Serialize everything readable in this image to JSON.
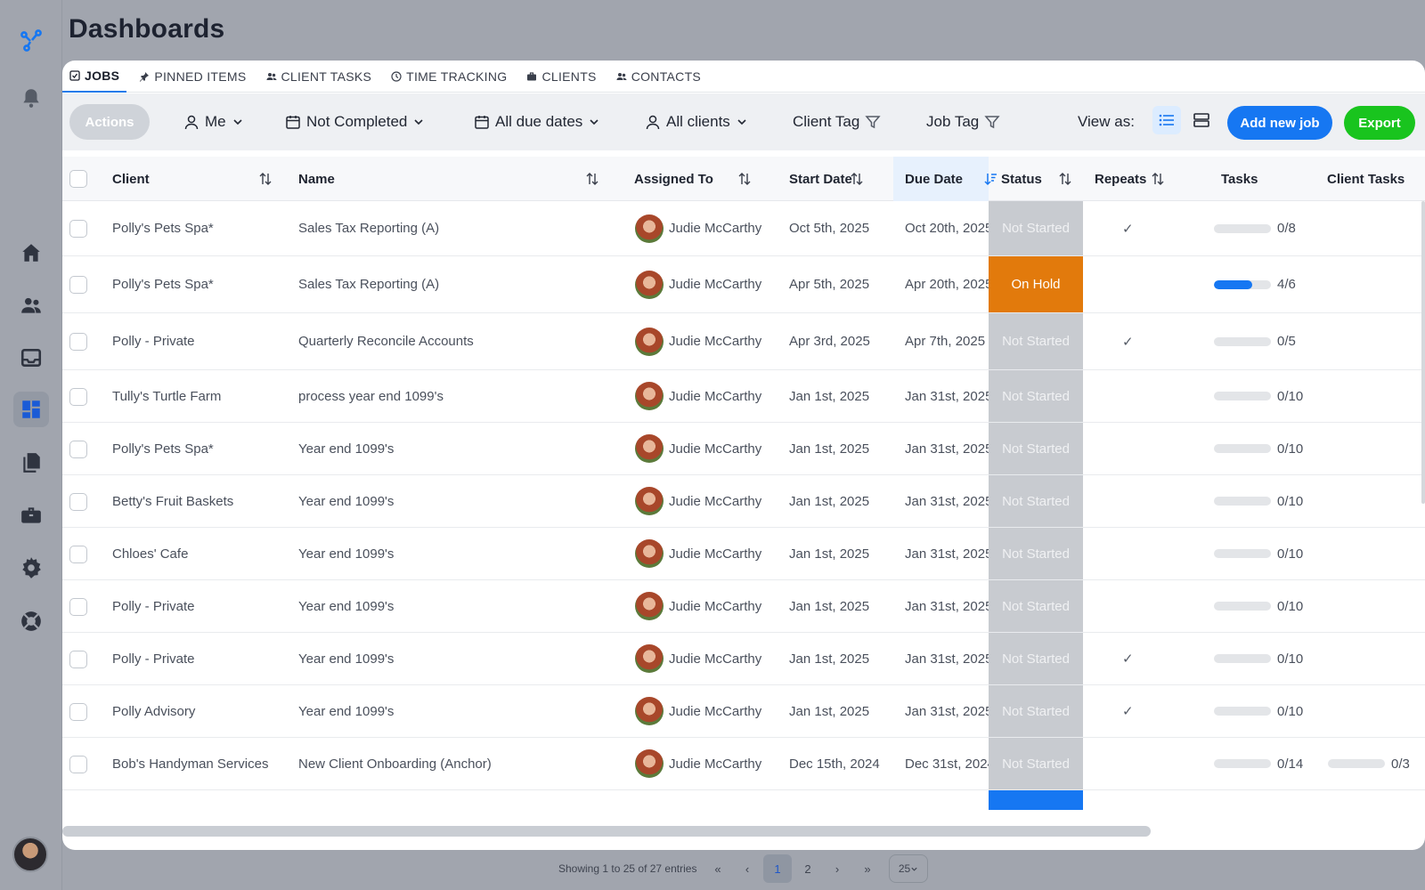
{
  "page": {
    "title": "Dashboards"
  },
  "colors": {
    "primary": "#1677f2",
    "export": "#19c41e",
    "on_hold": "#e27a0c",
    "not_started": "#c8cbd0",
    "in_progress": "#1677f2"
  },
  "sidebar": {
    "items": [
      {
        "name": "logo-icon"
      },
      {
        "name": "bell-icon"
      },
      {
        "name": "home-icon"
      },
      {
        "name": "users-icon"
      },
      {
        "name": "inbox-icon"
      },
      {
        "name": "dashboard-icon",
        "active": true
      },
      {
        "name": "documents-icon"
      },
      {
        "name": "briefcase-icon"
      },
      {
        "name": "gear-icon"
      },
      {
        "name": "help-icon"
      }
    ]
  },
  "tabs": [
    {
      "label": "JOBS",
      "icon": "check-square-icon",
      "active": true
    },
    {
      "label": "PINNED ITEMS",
      "icon": "pin-icon"
    },
    {
      "label": "CLIENT TASKS",
      "icon": "users-icon"
    },
    {
      "label": "TIME TRACKING",
      "icon": "clock-icon"
    },
    {
      "label": "CLIENTS",
      "icon": "briefcase-icon"
    },
    {
      "label": "CONTACTS",
      "icon": "users-icon"
    }
  ],
  "toolbar": {
    "actions_label": "Actions",
    "assignee": "Me",
    "status_filter": "Not Completed",
    "due_filter": "All due dates",
    "client_filter": "All clients",
    "client_tag": "Client Tag",
    "job_tag": "Job Tag",
    "view_as": "View as:",
    "add_label": "Add new job",
    "export_label": "Export"
  },
  "table": {
    "columns": {
      "client": "Client",
      "name": "Name",
      "assigned": "Assigned To",
      "start": "Start Date",
      "due": "Due Date",
      "status": "Status",
      "repeats": "Repeats",
      "tasks": "Tasks",
      "client_tasks": "Client Tasks"
    },
    "rows": [
      {
        "client": "Polly's Pets Spa*",
        "name": "Sales Tax Reporting (A)",
        "assigned": "Judie McCarthy",
        "start": "Oct 5th, 2025",
        "due": "Oct 20th, 2025",
        "status": "Not Started",
        "repeats": "✓",
        "tasks": "0/8",
        "tasks_fraction": 0,
        "client_tasks": ""
      },
      {
        "client": "Polly's Pets Spa*",
        "name": "Sales Tax Reporting (A)",
        "assigned": "Judie McCarthy",
        "start": "Apr 5th, 2025",
        "due": "Apr 20th, 2025",
        "status": "On Hold",
        "repeats": "",
        "tasks": "4/6",
        "tasks_fraction": 0.667,
        "client_tasks": ""
      },
      {
        "client": "Polly - Private",
        "name": "Quarterly Reconcile Accounts",
        "assigned": "Judie McCarthy",
        "start": "Apr 3rd, 2025",
        "due": "Apr 7th, 2025",
        "status": "Not Started",
        "repeats": "✓",
        "tasks": "0/5",
        "tasks_fraction": 0,
        "client_tasks": ""
      },
      {
        "client": "Tully's Turtle Farm",
        "name": "process year end 1099's",
        "assigned": "Judie McCarthy",
        "start": "Jan 1st, 2025",
        "due": "Jan 31st, 2025",
        "status": "Not Started",
        "repeats": "",
        "tasks": "0/10",
        "tasks_fraction": 0,
        "client_tasks": ""
      },
      {
        "client": "Polly's Pets Spa*",
        "name": "Year end 1099's",
        "assigned": "Judie McCarthy",
        "start": "Jan 1st, 2025",
        "due": "Jan 31st, 2025",
        "status": "Not Started",
        "repeats": "",
        "tasks": "0/10",
        "tasks_fraction": 0,
        "client_tasks": ""
      },
      {
        "client": "Betty's Fruit Baskets",
        "name": "Year end 1099's",
        "assigned": "Judie McCarthy",
        "start": "Jan 1st, 2025",
        "due": "Jan 31st, 2025",
        "status": "Not Started",
        "repeats": "",
        "tasks": "0/10",
        "tasks_fraction": 0,
        "client_tasks": ""
      },
      {
        "client": "Chloes' Cafe",
        "name": "Year end 1099's",
        "assigned": "Judie McCarthy",
        "start": "Jan 1st, 2025",
        "due": "Jan 31st, 2025",
        "status": "Not Started",
        "repeats": "",
        "tasks": "0/10",
        "tasks_fraction": 0,
        "client_tasks": ""
      },
      {
        "client": "Polly - Private",
        "name": "Year end 1099's",
        "assigned": "Judie McCarthy",
        "start": "Jan 1st, 2025",
        "due": "Jan 31st, 2025",
        "status": "Not Started",
        "repeats": "",
        "tasks": "0/10",
        "tasks_fraction": 0,
        "client_tasks": ""
      },
      {
        "client": "Polly - Private",
        "name": "Year end 1099's",
        "assigned": "Judie McCarthy",
        "start": "Jan 1st, 2025",
        "due": "Jan 31st, 2025",
        "status": "Not Started",
        "repeats": "✓",
        "tasks": "0/10",
        "tasks_fraction": 0,
        "client_tasks": ""
      },
      {
        "client": "Polly Advisory",
        "name": "Year end 1099's",
        "assigned": "Judie McCarthy",
        "start": "Jan 1st, 2025",
        "due": "Jan 31st, 2025",
        "status": "Not Started",
        "repeats": "✓",
        "tasks": "0/10",
        "tasks_fraction": 0,
        "client_tasks": ""
      },
      {
        "client": "Bob's Handyman Services",
        "name": "New Client Onboarding (Anchor)",
        "assigned": "Judie McCarthy",
        "start": "Dec 15th, 2024",
        "due": "Dec 31st, 2024",
        "status": "Not Started",
        "repeats": "",
        "tasks": "0/14",
        "tasks_fraction": 0,
        "client_tasks": "0/3",
        "client_tasks_fraction": 0
      }
    ]
  },
  "pagination": {
    "info": "Showing 1 to 25 of 27 entries",
    "first": "«",
    "prev": "‹",
    "pages": [
      "1",
      "2"
    ],
    "current": "1",
    "next": "›",
    "last": "»",
    "page_size": "25"
  }
}
